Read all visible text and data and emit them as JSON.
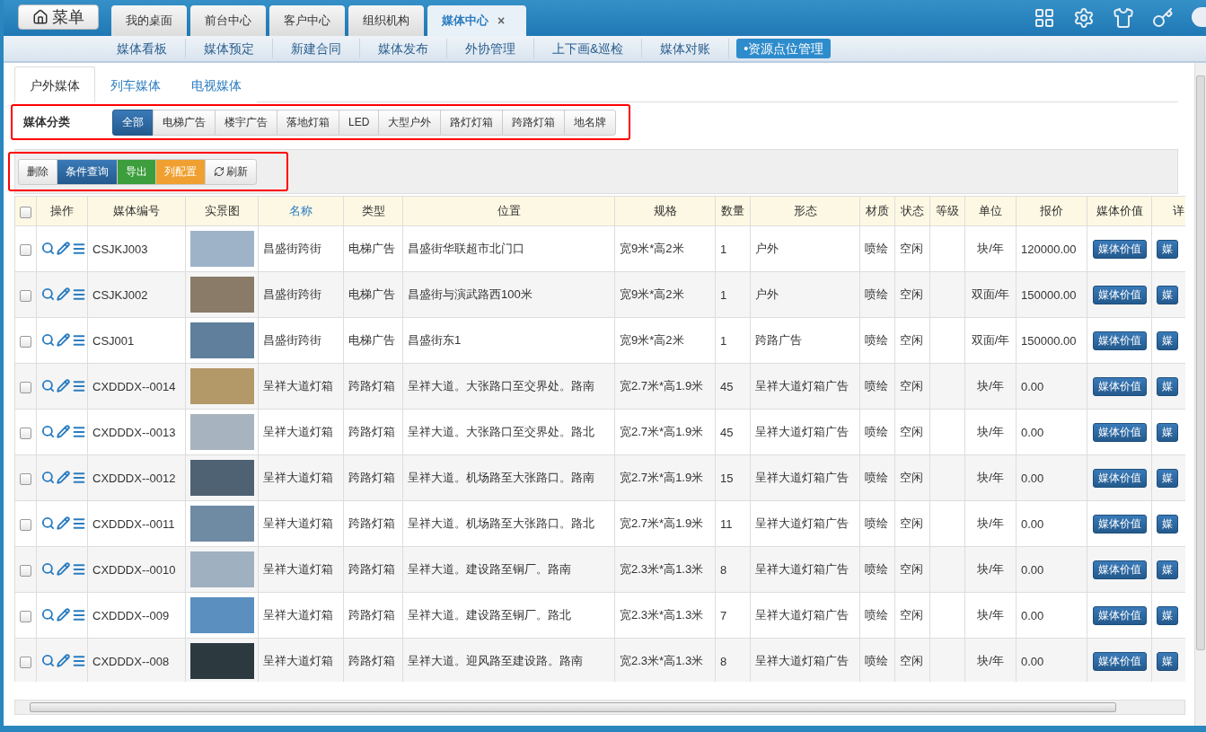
{
  "menu_button": {
    "label": "菜单"
  },
  "top_tabs": [
    {
      "label": "我的桌面",
      "selected": false
    },
    {
      "label": "前台中心",
      "selected": false
    },
    {
      "label": "客户中心",
      "selected": false
    },
    {
      "label": "组织机构",
      "selected": false
    },
    {
      "label": "媒体中心",
      "selected": true,
      "close": "×"
    }
  ],
  "sub_nav": [
    {
      "label": "媒体看板",
      "selected": false
    },
    {
      "label": "媒体预定",
      "selected": false
    },
    {
      "label": "新建合同",
      "selected": false
    },
    {
      "label": "媒体发布",
      "selected": false
    },
    {
      "label": "外协管理",
      "selected": false
    },
    {
      "label": "上下画&巡检",
      "selected": false
    },
    {
      "label": "媒体对账",
      "selected": false
    },
    {
      "label": "•资源点位管理",
      "selected": true
    }
  ],
  "media_tabs": [
    {
      "label": "户外媒体",
      "selected": true
    },
    {
      "label": "列车媒体",
      "selected": false
    },
    {
      "label": "电视媒体",
      "selected": false
    }
  ],
  "category_filter": {
    "label": "媒体分类",
    "options": [
      {
        "label": "全部",
        "selected": true
      },
      {
        "label": "电梯广告",
        "selected": false
      },
      {
        "label": "楼宇广告",
        "selected": false
      },
      {
        "label": "落地灯箱",
        "selected": false
      },
      {
        "label": "LED",
        "selected": false
      },
      {
        "label": "大型户外",
        "selected": false
      },
      {
        "label": "路灯灯箱",
        "selected": false
      },
      {
        "label": "跨路灯箱",
        "selected": false
      },
      {
        "label": "地名牌",
        "selected": false
      }
    ]
  },
  "toolbar": [
    {
      "label": "删除",
      "kind": "default"
    },
    {
      "label": "条件查询",
      "kind": "primary"
    },
    {
      "label": "导出",
      "kind": "success"
    },
    {
      "label": "列配置",
      "kind": "warning"
    },
    {
      "label": "刷新",
      "kind": "refresh"
    }
  ],
  "table": {
    "columns": [
      {
        "label": "操作",
        "sortable": false
      },
      {
        "label": "媒体编号",
        "sortable": false
      },
      {
        "label": "实景图",
        "sortable": false
      },
      {
        "label": "名称",
        "sortable": true
      },
      {
        "label": "类型",
        "sortable": false
      },
      {
        "label": "位置",
        "sortable": false
      },
      {
        "label": "规格",
        "sortable": false
      },
      {
        "label": "数量",
        "sortable": false
      },
      {
        "label": "形态",
        "sortable": false
      },
      {
        "label": "材质",
        "sortable": false
      },
      {
        "label": "状态",
        "sortable": false
      },
      {
        "label": "等级",
        "sortable": false
      },
      {
        "label": "单位",
        "sortable": false
      },
      {
        "label": "报价",
        "sortable": false
      },
      {
        "label": "媒体价值",
        "sortable": false
      },
      {
        "label": "详",
        "sortable": false
      }
    ],
    "header_checked": false,
    "rows": [
      {
        "checked": false,
        "code": "CSJKJ003",
        "name": "昌盛街跨街",
        "type": "电梯广告",
        "location": "昌盛街华联超市北门口",
        "spec": "宽9米*高2米",
        "quantity": "1",
        "form": "户外",
        "material": "喷绘",
        "status": "空闲",
        "unit": "块/年",
        "price": "120000.00",
        "value_button": "媒体价值",
        "detail_button": "媒"
      },
      {
        "checked": false,
        "code": "CSJKJ002",
        "name": "昌盛街跨街",
        "type": "电梯广告",
        "location": "昌盛街与演武路西100米",
        "spec": "宽9米*高2米",
        "quantity": "1",
        "form": "户外",
        "material": "喷绘",
        "status": "空闲",
        "unit": "双面/年",
        "price": "150000.00",
        "value_button": "媒体价值",
        "detail_button": "媒"
      },
      {
        "checked": false,
        "code": "CSJ001",
        "name": "昌盛街跨街",
        "type": "电梯广告",
        "location": "昌盛街东1",
        "spec": "宽9米*高2米",
        "quantity": "1",
        "form": "跨路广告",
        "material": "喷绘",
        "status": "空闲",
        "unit": "双面/年",
        "price": "150000.00",
        "value_button": "媒体价值",
        "detail_button": "媒"
      },
      {
        "checked": false,
        "code": "CXDDDX--0014",
        "name": "呈祥大道灯箱",
        "type": "跨路灯箱",
        "location": "呈祥大道。大张路口至交界处。路南",
        "spec": "宽2.7米*高1.9米",
        "quantity": "45",
        "form": "呈祥大道灯箱广告",
        "material": "喷绘",
        "status": "空闲",
        "unit": "块/年",
        "price": "0.00",
        "value_button": "媒体价值",
        "detail_button": "媒"
      },
      {
        "checked": false,
        "code": "CXDDDX--0013",
        "name": "呈祥大道灯箱",
        "type": "跨路灯箱",
        "location": "呈祥大道。大张路口至交界处。路北",
        "spec": "宽2.7米*高1.9米",
        "quantity": "45",
        "form": "呈祥大道灯箱广告",
        "material": "喷绘",
        "status": "空闲",
        "unit": "块/年",
        "price": "0.00",
        "value_button": "媒体价值",
        "detail_button": "媒"
      },
      {
        "checked": false,
        "code": "CXDDDX--0012",
        "name": "呈祥大道灯箱",
        "type": "跨路灯箱",
        "location": "呈祥大道。机场路至大张路口。路南",
        "spec": "宽2.7米*高1.9米",
        "quantity": "15",
        "form": "呈祥大道灯箱广告",
        "material": "喷绘",
        "status": "空闲",
        "unit": "块/年",
        "price": "0.00",
        "value_button": "媒体价值",
        "detail_button": "媒"
      },
      {
        "checked": false,
        "code": "CXDDDX--0011",
        "name": "呈祥大道灯箱",
        "type": "跨路灯箱",
        "location": "呈祥大道。机场路至大张路口。路北",
        "spec": "宽2.7米*高1.9米",
        "quantity": "11",
        "form": "呈祥大道灯箱广告",
        "material": "喷绘",
        "status": "空闲",
        "unit": "块/年",
        "price": "0.00",
        "value_button": "媒体价值",
        "detail_button": "媒"
      },
      {
        "checked": false,
        "code": "CXDDDX--0010",
        "name": "呈祥大道灯箱",
        "type": "跨路灯箱",
        "location": "呈祥大道。建设路至铜厂。路南",
        "spec": "宽2.3米*高1.3米",
        "quantity": "8",
        "form": "呈祥大道灯箱广告",
        "material": "喷绘",
        "status": "空闲",
        "unit": "块/年",
        "price": "0.00",
        "value_button": "媒体价值",
        "detail_button": "媒"
      },
      {
        "checked": false,
        "code": "CXDDDX--009",
        "name": "呈祥大道灯箱",
        "type": "跨路灯箱",
        "location": "呈祥大道。建设路至铜厂。路北",
        "spec": "宽2.3米*高1.3米",
        "quantity": "7",
        "form": "呈祥大道灯箱广告",
        "material": "喷绘",
        "status": "空闲",
        "unit": "块/年",
        "price": "0.00",
        "value_button": "媒体价值",
        "detail_button": "媒"
      },
      {
        "checked": false,
        "code": "CXDDDX--008",
        "name": "呈祥大道灯箱",
        "type": "跨路灯箱",
        "location": "呈祥大道。迎风路至建设路。路南",
        "spec": "宽2.3米*高1.3米",
        "quantity": "8",
        "form": "呈祥大道灯箱广告",
        "material": "喷绘",
        "status": "空闲",
        "unit": "块/年",
        "price": "0.00",
        "value_button": "媒体价值",
        "detail_button": "媒"
      }
    ]
  }
}
